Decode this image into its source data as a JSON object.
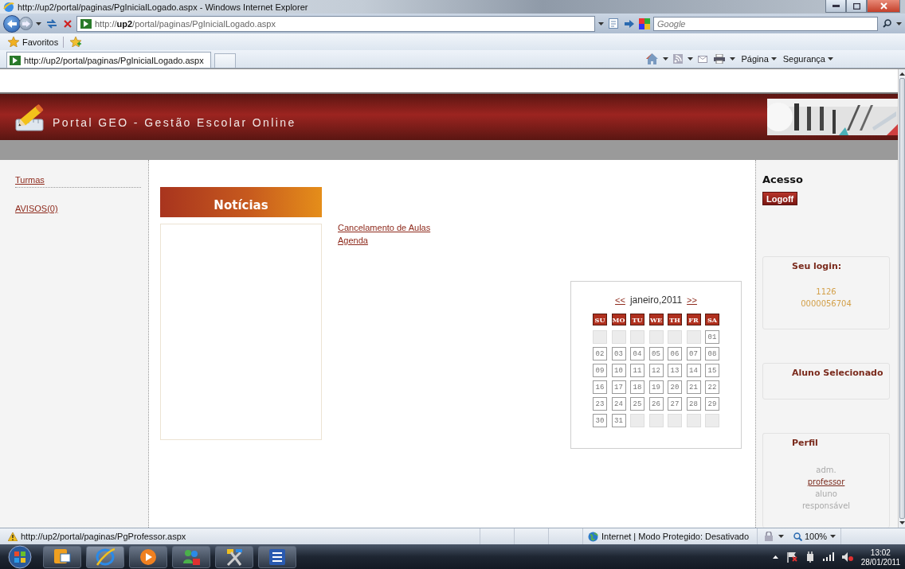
{
  "browser": {
    "title": "http://up2/portal/paginas/PgInicialLogado.aspx - Windows Internet Explorer",
    "address": "http://**up2**/portal/paginas/PgInicialLogado.aspx",
    "search": {
      "placeholder": "Google"
    },
    "favorites": "Favoritos",
    "tab": {
      "label": "http://up2/portal/paginas/PgInicialLogado.aspx",
      "selected": true
    },
    "commands": [
      "Página",
      "Segurança"
    ]
  },
  "page": {
    "title": "Portal GEO - Gestão Escolar Online",
    "sidebar": [
      {
        "label": "Turmas"
      },
      {
        "label": "AVISOS(0)"
      }
    ],
    "news": {
      "title": "Notícias",
      "links": [
        "Cancelamento de Aulas",
        "Agenda"
      ]
    },
    "calendar": {
      "prev": "<<",
      "month": "janeiro,2011",
      "next": ">>",
      "weekdays": [
        "SU",
        "MO",
        "TU",
        "WE",
        "TH",
        "FR",
        "SA"
      ],
      "weeks": [
        [
          {
            "kind": "empty"
          },
          {
            "kind": "empty"
          },
          {
            "kind": "empty"
          },
          {
            "kind": "empty"
          },
          {
            "kind": "empty"
          },
          {
            "kind": "empty"
          },
          {
            "kind": "day",
            "label": "01"
          }
        ],
        [
          {
            "kind": "day",
            "label": "02"
          },
          {
            "kind": "day",
            "label": "03"
          },
          {
            "kind": "day",
            "label": "04"
          },
          {
            "kind": "day",
            "label": "05"
          },
          {
            "kind": "day",
            "label": "06"
          },
          {
            "kind": "day",
            "label": "07"
          },
          {
            "kind": "day",
            "label": "08"
          }
        ],
        [
          {
            "kind": "day",
            "label": "09"
          },
          {
            "kind": "day",
            "label": "10"
          },
          {
            "kind": "day",
            "label": "11"
          },
          {
            "kind": "day",
            "label": "12"
          },
          {
            "kind": "day",
            "label": "13"
          },
          {
            "kind": "day",
            "label": "14"
          },
          {
            "kind": "day",
            "label": "15"
          }
        ],
        [
          {
            "kind": "day",
            "label": "16"
          },
          {
            "kind": "day",
            "label": "17"
          },
          {
            "kind": "day",
            "label": "18"
          },
          {
            "kind": "day",
            "label": "19"
          },
          {
            "kind": "day",
            "label": "20"
          },
          {
            "kind": "day",
            "label": "21"
          },
          {
            "kind": "day",
            "label": "22"
          }
        ],
        [
          {
            "kind": "day",
            "label": "23"
          },
          {
            "kind": "day",
            "label": "24"
          },
          {
            "kind": "day",
            "label": "25"
          },
          {
            "kind": "day",
            "label": "26"
          },
          {
            "kind": "day",
            "label": "27"
          },
          {
            "kind": "day",
            "label": "28"
          },
          {
            "kind": "day",
            "label": "29"
          }
        ],
        [
          {
            "kind": "day",
            "label": "30"
          },
          {
            "kind": "day",
            "label": "31"
          },
          {
            "kind": "empty"
          },
          {
            "kind": "empty"
          },
          {
            "kind": "empty"
          },
          {
            "kind": "empty"
          },
          {
            "kind": "empty"
          }
        ]
      ]
    },
    "access": {
      "title": "Acesso",
      "button": "Logoff"
    },
    "login": {
      "title": "Seu login:",
      "lines": [
        "1126",
        "0000056704"
      ]
    },
    "student": {
      "title": "Aluno Selecionado"
    },
    "profile": {
      "title": "Perfil",
      "options": [
        {
          "label": "adm.",
          "selected": false
        },
        {
          "label": "professor",
          "selected": true
        },
        {
          "label": "aluno",
          "selected": false
        },
        {
          "label": "responsável",
          "selected": false
        }
      ]
    }
  },
  "status_bar": {
    "url": "http://up2/portal/paginas/PgProfessor.aspx",
    "zone": "Internet | Modo Protegido: Desativado",
    "zoom": "100%"
  },
  "taskbar": {
    "time": "13:02",
    "date": "28/01/2011"
  }
}
